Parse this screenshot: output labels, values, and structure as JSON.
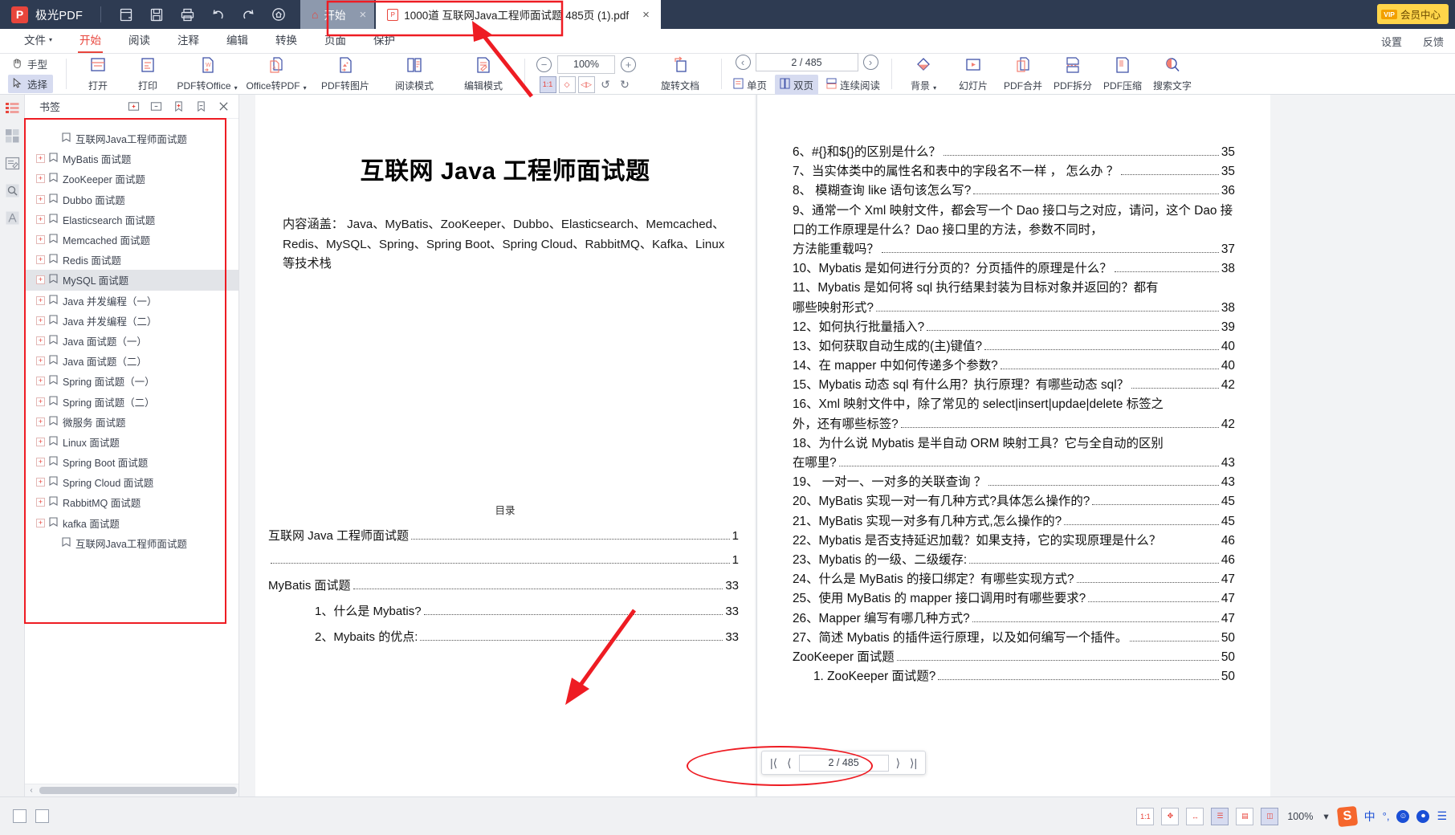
{
  "titlebar": {
    "app_name": "极光PDF",
    "logo_letter": "P",
    "icons": [
      "new-file-icon",
      "save-icon",
      "print-icon",
      "undo-icon",
      "redo-icon",
      "home-circle-icon"
    ],
    "tabs": [
      {
        "label": "开始",
        "icon": "home-icon",
        "close": "×"
      },
      {
        "label": "1000道 互联网Java工程师面试题 485页 (1).pdf",
        "icon": "pdf-file-icon",
        "close": "×"
      }
    ],
    "member_button": {
      "badge": "VIP",
      "label": "会员中心"
    }
  },
  "menubar": {
    "items": [
      {
        "label": "文件",
        "caret": "▾"
      },
      {
        "label": "开始"
      },
      {
        "label": "阅读"
      },
      {
        "label": "注释"
      },
      {
        "label": "编辑"
      },
      {
        "label": "转换"
      },
      {
        "label": "页面"
      },
      {
        "label": "保护"
      }
    ],
    "right": [
      {
        "label": "设置"
      },
      {
        "label": "反馈"
      }
    ]
  },
  "ribbon": {
    "hand_tool": "手型",
    "select_tool": "选择",
    "buttons": [
      {
        "label": "打开",
        "icon": "open-folder-icon"
      },
      {
        "label": "打印",
        "icon": "printer-icon"
      },
      {
        "label": "PDF转Office",
        "icon": "pdf-to-word-icon",
        "caret": "▾"
      },
      {
        "label": "Office转PDF",
        "icon": "office-to-pdf-icon",
        "caret": "▾"
      },
      {
        "label": "PDF转图片",
        "icon": "pdf-to-image-icon"
      },
      {
        "label": "阅读模式",
        "icon": "read-mode-icon"
      },
      {
        "label": "编辑模式",
        "icon": "edit-mode-icon"
      }
    ],
    "zoom": {
      "minus": "−",
      "value": "100%",
      "plus": "+"
    },
    "fit_buttons": [
      {
        "icon": "actual-size-icon",
        "label": "1:1",
        "active": true
      },
      {
        "icon": "fit-page-icon",
        "label": "◇"
      },
      {
        "icon": "fit-width-icon",
        "label": "◁▷"
      },
      {
        "icon": "rotate-left-icon",
        "label": "↺"
      },
      {
        "icon": "rotate-right-icon",
        "label": "↻"
      }
    ],
    "rotate_doc": {
      "label": "旋转文档",
      "icon": "rotate-doc-icon"
    },
    "page_nav": {
      "prev": "‹",
      "value": "2 / 485",
      "next": "›"
    },
    "view_modes": [
      {
        "label": "单页",
        "icon": "single-page-icon",
        "active": false
      },
      {
        "label": "双页",
        "icon": "double-page-icon",
        "active": true
      },
      {
        "label": "连续阅读",
        "icon": "continuous-scroll-icon",
        "active": false
      }
    ],
    "right_buttons": [
      {
        "label": "背景",
        "icon": "background-icon",
        "caret": "▾"
      },
      {
        "label": "幻灯片",
        "icon": "slideshow-icon"
      },
      {
        "label": "PDF合并",
        "icon": "pdf-merge-icon"
      },
      {
        "label": "PDF拆分",
        "icon": "pdf-split-icon"
      },
      {
        "label": "PDF压缩",
        "icon": "pdf-compress-icon"
      },
      {
        "label": "搜索文字",
        "icon": "search-text-icon"
      }
    ]
  },
  "rail": {
    "items": [
      {
        "name": "bookmark-list-icon",
        "active": true
      },
      {
        "name": "thumbnails-icon",
        "active": false
      },
      {
        "name": "annotations-icon",
        "active": false
      },
      {
        "name": "search-icon",
        "active": false
      },
      {
        "name": "signature-icon",
        "active": false
      }
    ]
  },
  "bookmarks": {
    "title": "书签",
    "tools": [
      "expand-all-icon",
      "collapse-all-icon",
      "add-bookmark-icon",
      "delete-bookmark-icon",
      "close-panel-icon"
    ],
    "items": [
      {
        "label": "互联网Java工程师面试题",
        "expandable": false,
        "indent": 1,
        "selected": false
      },
      {
        "label": "MyBatis 面试题",
        "expandable": true,
        "indent": 0,
        "selected": false
      },
      {
        "label": "ZooKeeper 面试题",
        "expandable": true,
        "indent": 0,
        "selected": false
      },
      {
        "label": "Dubbo 面试题",
        "expandable": true,
        "indent": 0,
        "selected": false
      },
      {
        "label": "Elasticsearch 面试题",
        "expandable": true,
        "indent": 0,
        "selected": false
      },
      {
        "label": "Memcached 面试题",
        "expandable": true,
        "indent": 0,
        "selected": false
      },
      {
        "label": "Redis 面试题",
        "expandable": true,
        "indent": 0,
        "selected": false
      },
      {
        "label": "MySQL 面试题",
        "expandable": true,
        "indent": 0,
        "selected": true
      },
      {
        "label": "Java 并发编程（一）",
        "expandable": true,
        "indent": 0,
        "selected": false
      },
      {
        "label": "Java 并发编程（二）",
        "expandable": true,
        "indent": 0,
        "selected": false
      },
      {
        "label": "Java 面试题（一）",
        "expandable": true,
        "indent": 0,
        "selected": false
      },
      {
        "label": "Java 面试题（二）",
        "expandable": true,
        "indent": 0,
        "selected": false
      },
      {
        "label": "Spring 面试题（一）",
        "expandable": true,
        "indent": 0,
        "selected": false
      },
      {
        "label": "Spring 面试题（二）",
        "expandable": true,
        "indent": 0,
        "selected": false
      },
      {
        "label": "微服务 面试题",
        "expandable": true,
        "indent": 0,
        "selected": false
      },
      {
        "label": "Linux 面试题",
        "expandable": true,
        "indent": 0,
        "selected": false
      },
      {
        "label": "Spring Boot 面试题",
        "expandable": true,
        "indent": 0,
        "selected": false
      },
      {
        "label": "Spring Cloud 面试题",
        "expandable": true,
        "indent": 0,
        "selected": false
      },
      {
        "label": "RabbitMQ 面试题",
        "expandable": true,
        "indent": 0,
        "selected": false
      },
      {
        "label": "kafka 面试题",
        "expandable": true,
        "indent": 0,
        "selected": false
      },
      {
        "label": "互联网Java工程师面试题",
        "expandable": false,
        "indent": 1,
        "selected": false
      }
    ]
  },
  "document": {
    "left_page": {
      "title": "互联网 Java 工程师面试题",
      "paragraph": "内容涵盖： Java、MyBatis、ZooKeeper、Dubbo、Elasticsearch、Memcached、Redis、MySQL、Spring、Spring Boot、Spring Cloud、RabbitMQ、Kafka、Linux 等技术栈",
      "toc_heading": "目录",
      "toc": [
        {
          "text": "互联网 Java 工程师面试题",
          "page": "1",
          "level": 1
        },
        {
          "text": "",
          "page": "1",
          "level": 1
        },
        {
          "text": "MyBatis 面试题",
          "page": "33",
          "level": 1
        },
        {
          "text": "1、什么是 Mybatis?",
          "page": "33",
          "level": 2
        },
        {
          "text": "2、Mybaits 的优点:",
          "page": "33",
          "level": 2
        }
      ]
    },
    "right_page": {
      "entries": [
        {
          "text": "6、#{}和${}的区别是什么？",
          "page": "35",
          "wrap": false
        },
        {
          "text": "7、当实体类中的属性名和表中的字段名不一样 ， 怎么办 ？",
          "page": "35",
          "wrap": false
        },
        {
          "text": "8、 模糊查询 like 语句该怎么写?",
          "page": "36",
          "wrap": false
        },
        {
          "text": "9、通常一个 Xml 映射文件，都会写一个 Dao 接口与之对应，请问，这个 Dao 接口的工作原理是什么？Dao 接口里的方法，参数不同时，方法能重载吗？",
          "page": "37",
          "wrap": true,
          "last_line": "方法能重载吗？"
        },
        {
          "text": "10、Mybatis 是如何进行分页的？分页插件的原理是什么？",
          "page": "38",
          "wrap": false
        },
        {
          "text": "11、Mybatis 是如何将 sql 执行结果封装为目标对象并返回的？都有哪些映射形式?",
          "page": "38",
          "wrap": true,
          "last_line": "哪些映射形式?"
        },
        {
          "text": "12、如何执行批量插入?",
          "page": "39",
          "wrap": false
        },
        {
          "text": "13、如何获取自动生成的(主)键值?",
          "page": "40",
          "wrap": false
        },
        {
          "text": "14、在 mapper 中如何传递多个参数?",
          "page": "40",
          "wrap": false
        },
        {
          "text": "15、Mybatis 动态 sql 有什么用？执行原理？有哪些动态 sql？",
          "page": "42",
          "wrap": false
        },
        {
          "text": "16、Xml 映射文件中，除了常见的 select|insert|updae|delete 标签之外，还有哪些标签?",
          "page": "42",
          "wrap": true,
          "last_line": "外，还有哪些标签?"
        },
        {
          "text": "18、为什么说 Mybatis 是半自动 ORM 映射工具？它与全自动的区别在哪里?",
          "page": "43",
          "wrap": true,
          "last_line": "在哪里?"
        },
        {
          "text": "19、 一对一、一对多的关联查询 ？",
          "page": "43",
          "wrap": false
        },
        {
          "text": "20、MyBatis 实现一对一有几种方式?具体怎么操作的?",
          "page": "45",
          "wrap": false
        },
        {
          "text": "21、MyBatis 实现一对多有几种方式,怎么操作的?",
          "page": "45",
          "wrap": false
        },
        {
          "text": "22、Mybatis 是否支持延迟加载？如果支持，它的实现原理是什么？",
          "page": "46",
          "wrap": false,
          "nodots": true
        },
        {
          "text": "23、Mybatis 的一级、二级缓存:",
          "page": "46",
          "wrap": false
        },
        {
          "text": "24、什么是 MyBatis 的接口绑定？有哪些实现方式?",
          "page": "47",
          "wrap": false
        },
        {
          "text": "25、使用 MyBatis 的 mapper 接口调用时有哪些要求?",
          "page": "47",
          "wrap": false
        },
        {
          "text": "26、Mapper 编写有哪几种方式?",
          "page": "47",
          "wrap": false
        },
        {
          "text": "27、简述 Mybatis 的插件运行原理，以及如何编写一个插件。",
          "page": "50",
          "wrap": false
        },
        {
          "text": "ZooKeeper 面试题",
          "page": "50",
          "wrap": false,
          "level1": true
        },
        {
          "text": "1. ZooKeeper 面试题?",
          "page": "50",
          "wrap": false,
          "indent": true
        }
      ]
    }
  },
  "page_nav_bar": {
    "first": "|⟨",
    "prev": "⟨",
    "value": "2 / 485",
    "next": "⟩",
    "last": "⟩|"
  },
  "statusbar": {
    "left_icons": [
      "page-thumb-icon",
      "page-grid-icon"
    ],
    "right_icons": [
      {
        "name": "actual-size-icon",
        "glyph": "1:1",
        "active": false
      },
      {
        "name": "fit-page-icon",
        "glyph": "✥",
        "active": false
      },
      {
        "name": "fit-width-icon",
        "glyph": "↔",
        "active": false
      },
      {
        "name": "continuous-view-icon",
        "glyph": "☰",
        "active": true
      },
      {
        "name": "single-page-view-icon",
        "glyph": "▤",
        "active": false
      },
      {
        "name": "double-page-view-icon",
        "glyph": "◫",
        "active": true
      }
    ],
    "zoom": "100%",
    "zoom_caret": "▾",
    "ime": {
      "logo": "S",
      "mode": "中",
      "punct": "°,",
      "emoji": "☺",
      "mic": "⏺",
      "more": "☰"
    }
  },
  "colors": {
    "titlebar_bg": "#2e3b52",
    "accent_red": "#e8453c",
    "annotation_red": "#ee1c23",
    "selection_blue": "#d6dbf0",
    "member_yellow": "#ffd54a"
  }
}
